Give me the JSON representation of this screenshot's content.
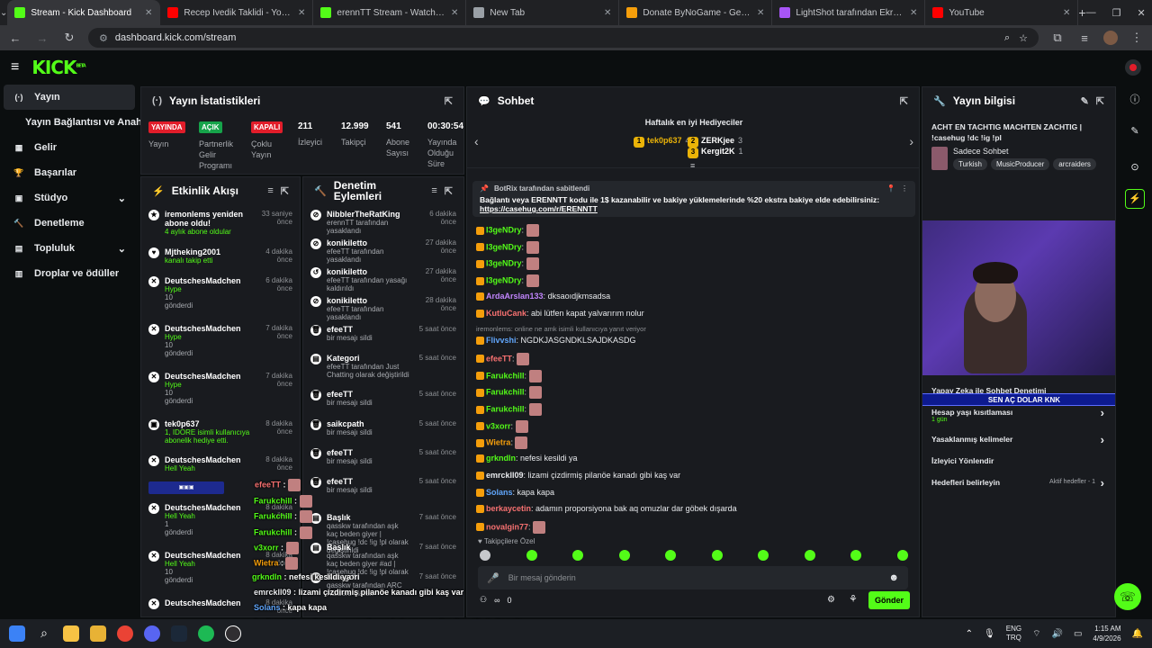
{
  "browser": {
    "tabs": [
      {
        "title": "Stream - Kick Dashboard",
        "color": "#53fc18",
        "active": true
      },
      {
        "title": "Recep İvedik Taklidi - YouTube",
        "color": "#ff0000"
      },
      {
        "title": "erennTT Stream - Watch Live o",
        "color": "#53fc18"
      },
      {
        "title": "New Tab",
        "color": "#9aa0a6"
      },
      {
        "title": "Donate ByNoGame - Gelen/Gid",
        "color": "#f59e0b"
      },
      {
        "title": "LightShot tarafından Ekran Gör",
        "color": "#a855f7"
      },
      {
        "title": "YouTube",
        "color": "#ff0000"
      }
    ],
    "new_tab": "+",
    "url": "dashboard.kick.com/stream"
  },
  "kick": {
    "logo": "KICK",
    "logo_sup": "BETA"
  },
  "sidebar": {
    "items": [
      {
        "label": "Yayın",
        "icon": "radio-icon",
        "glyph": "((·))"
      },
      {
        "label": "Yayın Bağlantısı ve Anahtarı",
        "icon": "",
        "glyph": ""
      },
      {
        "label": "Gelir",
        "icon": "revenue-icon",
        "glyph": "▦"
      },
      {
        "label": "Başarılar",
        "icon": "trophy-icon",
        "glyph": "🏆"
      },
      {
        "label": "Stüdyo",
        "icon": "studio-icon",
        "glyph": "▣",
        "chevron": "⌄"
      },
      {
        "label": "Denetleme",
        "icon": "hammer-icon",
        "glyph": "🔨"
      },
      {
        "label": "Topluluk",
        "icon": "community-icon",
        "glyph": "▤",
        "chevron": "⌄"
      },
      {
        "label": "Droplar ve ödüller",
        "icon": "gift-icon",
        "glyph": "▥"
      }
    ]
  },
  "stats": {
    "title": "Yayın İstatistikleri",
    "items": [
      {
        "badge": "YAYINDA",
        "badge_color": "#e11d2a",
        "label": "Yayın"
      },
      {
        "badge": "AÇIK",
        "badge_color": "#16a34a",
        "label": "Partnerlik Gelir Programı"
      },
      {
        "badge": "KAPALI",
        "badge_color": "#e11d2a",
        "label": "Çoklu Yayın"
      },
      {
        "value": "211",
        "label": "İzleyici"
      },
      {
        "value": "12.999",
        "label": "Takipçi"
      },
      {
        "value": "541",
        "label": "Abone Sayısı"
      },
      {
        "value": "00:30:54",
        "label": "Yayında Olduğu Süre"
      }
    ]
  },
  "activity": {
    "title": "Etkinlik Akışı",
    "events": [
      {
        "name": "iremonlems yeniden abone oldu!",
        "time": "33 saniye önce",
        "sub": "4 aylık abone oldular",
        "icon": "★"
      },
      {
        "name": "Mjtheking2001",
        "time": "4 dakika önce",
        "sub": "kanalı takip etti",
        "icon": "♥"
      },
      {
        "name": "DeutschesMadchen",
        "time": "6 dakika önce",
        "sub": "Hype",
        "count": "10",
        "sub2": "gönderdi",
        "icon": "✕"
      },
      {
        "name": "DeutschesMadchen",
        "time": "7 dakika önce",
        "sub": "Hype",
        "count": "10",
        "sub2": "gönderdi",
        "icon": "✕"
      },
      {
        "name": "DeutschesMadchen",
        "time": "7 dakika önce",
        "sub": "Hype",
        "count": "10",
        "sub2": "gönderdi",
        "icon": "✕"
      },
      {
        "name": "tek0p637",
        "time": "8 dakika önce",
        "sub": "1, IDORE isimli kullanıcıya abonelik hediye etti.",
        "icon": "▣"
      },
      {
        "name": "DeutschesMadchen",
        "time": "8 dakika önce",
        "sub": "Hell Yeah",
        "icon": "✕"
      },
      {
        "name": "DeutschesMadchen",
        "time": "8 dakika önce",
        "sub": "Hell Yeah",
        "count": "1",
        "sub2": "gönderdi",
        "icon": "✕"
      },
      {
        "name": "DeutschesMadchen",
        "time": "8 dakika önce",
        "sub": "Hell Yeah",
        "count": "10",
        "sub2": "gönderdi",
        "icon": "✕"
      },
      {
        "name": "DeutschesMadchen",
        "time": "8 dakika önce",
        "sub": "",
        "icon": "✕"
      }
    ]
  },
  "moderation": {
    "title": "Denetim Eylemleri",
    "events": [
      {
        "name": "NibblerTheRatKing",
        "time": "6 dakika önce",
        "sub": "erennTT tarafından yasaklandı",
        "icon": "⊘"
      },
      {
        "name": "konikiletto",
        "time": "27 dakika önce",
        "sub": "efeeTT tarafından yasaklandı",
        "icon": "⊘"
      },
      {
        "name": "konikiletto",
        "time": "27 dakika önce",
        "sub": "efeeTT tarafından yasağı kaldırıldı",
        "icon": "↺"
      },
      {
        "name": "konikiletto",
        "time": "28 dakika önce",
        "sub": "efeeTT tarafından yasaklandı",
        "icon": "⊘"
      },
      {
        "name": "efeeTT",
        "time": "5 saat önce",
        "sub": "bir mesajı sildi",
        "icon": "🗑"
      },
      {
        "name": "Kategori",
        "time": "5 saat önce",
        "sub": "efeeTT tarafından Just Chatting olarak değiştirildi",
        "icon": "▤"
      },
      {
        "name": "efeeTT",
        "time": "5 saat önce",
        "sub": "bir mesajı sildi",
        "icon": "🗑"
      },
      {
        "name": "saikcpath",
        "time": "5 saat önce",
        "sub": "bir mesajı sildi",
        "icon": "🗑"
      },
      {
        "name": "efeeTT",
        "time": "5 saat önce",
        "sub": "bir mesajı sildi",
        "icon": "🗑"
      },
      {
        "name": "efeeTT",
        "time": "5 saat önce",
        "sub": "bir mesajı sildi",
        "icon": "🗑"
      },
      {
        "name": "Başlık",
        "time": "7 saat önce",
        "sub": "qasskw tarafından aşk kaç beden giyer | !casehug !dc !ig !pl olarak değiştirildi",
        "icon": "▤"
      },
      {
        "name": "Başlık",
        "time": "7 saat önce",
        "sub": "qasskw tarafından aşk kaç beden giyer #ad | !casehug !dc !ig !pl olarak",
        "icon": "▤"
      },
      {
        "name": "Kategori",
        "time": "7 saat önce",
        "sub": "qasskw tarafından ARC Raiders olarak",
        "icon": "▤"
      }
    ]
  },
  "chat": {
    "title": "Sohbet",
    "top_gifters_title": "Haftalık en iyi Hediyeciler",
    "gifters": [
      {
        "rank": "1",
        "name": "tek0p637",
        "count": "4"
      },
      {
        "rank": "2",
        "name": "ZERKjee",
        "count": "3"
      },
      {
        "rank": "3",
        "name": "Kergit2K",
        "count": "1"
      }
    ],
    "pinned_by": "BotRix tarafından sabitlendi",
    "pinned_text": "Bağlantı veya ERENNTT kodu ile 1$ kazanabilir ve bakiye yüklemelerinde %20 ekstra bakiye elde edebilirsiniz:",
    "pinned_link": "https://casehug.com/r/ERENNTT",
    "messages": [
      {
        "user": "I3geNDry",
        "color": "#53fc18",
        "text": "",
        "emote": true
      },
      {
        "user": "I3geNDry",
        "color": "#53fc18",
        "text": "",
        "emote": true
      },
      {
        "user": "I3geNDry",
        "color": "#53fc18",
        "text": "",
        "emote": true
      },
      {
        "user": "I3geNDry",
        "color": "#53fc18",
        "text": "",
        "emote": true
      },
      {
        "user": "ArdaArslan133",
        "color": "#c084fc",
        "text": "dksaoıdjkmsadsa"
      },
      {
        "user": "KutluCank",
        "color": "#f87171",
        "text": "abi lütfen kapat yalvarırım nolur"
      },
      {
        "user": "Flivvshi",
        "color": "#60a5fa",
        "text": "NGDKJASGNDKLSAJDKASDG",
        "reply": "iremonlems: online ne amk isimli kullanıcıya yanıt veriyor"
      },
      {
        "user": "efeeTT",
        "color": "#f87171",
        "text": "",
        "emote": true
      },
      {
        "user": "Farukchill",
        "color": "#53fc18",
        "text": "",
        "emote": true
      },
      {
        "user": "Farukchill",
        "color": "#53fc18",
        "text": "",
        "emote": true
      },
      {
        "user": "Farukchill",
        "color": "#53fc18",
        "text": "",
        "emote": true
      },
      {
        "user": "v3xorr",
        "color": "#53fc18",
        "text": "",
        "emote": true
      },
      {
        "user": "Wietra",
        "color": "#f59e0b",
        "text": "",
        "emote": true
      },
      {
        "user": "grkndln",
        "color": "#53fc18",
        "text": "nefesi kesildi ya"
      },
      {
        "user": "emrckll09",
        "color": "#e8eaed",
        "text": "lizami çizdirmiş pilanöe kanadı gibi kaş var"
      },
      {
        "user": "Solans",
        "color": "#60a5fa",
        "text": "kapa kapa"
      },
      {
        "user": "berkaycetin",
        "color": "#f87171",
        "text": "adamın proporsiyona bak aq omuzlar dar göbek dışarda"
      },
      {
        "user": "novalgin77",
        "color": "#f87171",
        "text": "",
        "emote": true
      }
    ],
    "followers_only": "Takipçilere Özel",
    "input_placeholder": "Bir mesaj gönderin",
    "viewers": "0",
    "send": "Gönder"
  },
  "stream_info": {
    "title": "Yayın bilgisi",
    "stream_title": "ACHT EN TACHTIG MACHTEN ZACHTIG | !casehug !dc !ig !pl",
    "category": "Sadece Sohbet",
    "tags": [
      "Turkish",
      "MusicProducer",
      "arcraiders"
    ]
  },
  "settings": {
    "ai_mod": "Yapay Zeka ile Sohbet Denetimi",
    "goal_bar": {
      "left": "9",
      "label": "SEN AÇ DOLAR KNK",
      "right": "10"
    },
    "rows": [
      {
        "label": "Hesap yaşı kısıtlaması",
        "sub": "1 gün"
      },
      {
        "label": "Yasaklanmış kelimeler",
        "sub": ""
      },
      {
        "label": "İzleyici Yönlendir",
        "sub": ""
      },
      {
        "label": "Hedefleri belirleyin",
        "sub": "Aktif hedefler - 1"
      }
    ]
  },
  "overlay": {
    "lines": [
      {
        "user": "efeeTT",
        "color": "#f87171",
        "text": ""
      },
      {
        "user": "Farukchill",
        "color": "#53fc18",
        "text": ""
      },
      {
        "user": "Farukchill",
        "color": "#53fc18",
        "text": ""
      },
      {
        "user": "Farukchill",
        "color": "#53fc18",
        "text": ""
      },
      {
        "user": "v3xorr",
        "color": "#53fc18",
        "text": ""
      },
      {
        "user": "Wietra",
        "color": "#f59e0b",
        "text": ""
      },
      {
        "user": "grkndln",
        "color": "#53fc18",
        "text": "nefesi kesildi ya"
      },
      {
        "user": "emrckll09",
        "color": "#e8eaed",
        "text": "lizami çizdirmiş pilanöe kanadı gibi kaş var"
      },
      {
        "user": "Solans",
        "color": "#60a5fa",
        "text": "kapa kapa"
      },
      {
        "user": "berkaycetin",
        "color": "#f87171",
        "text": "adamın proporsiyona bak aq omuzlar dar göbek dışarda"
      },
      {
        "user": "novalgin77",
        "color": "#f87171",
        "text": ""
      }
    ]
  },
  "taskbar": {
    "lang": "ENG",
    "lang2": "TRQ",
    "time": "1:15 AM",
    "date": "4/9/2026"
  }
}
